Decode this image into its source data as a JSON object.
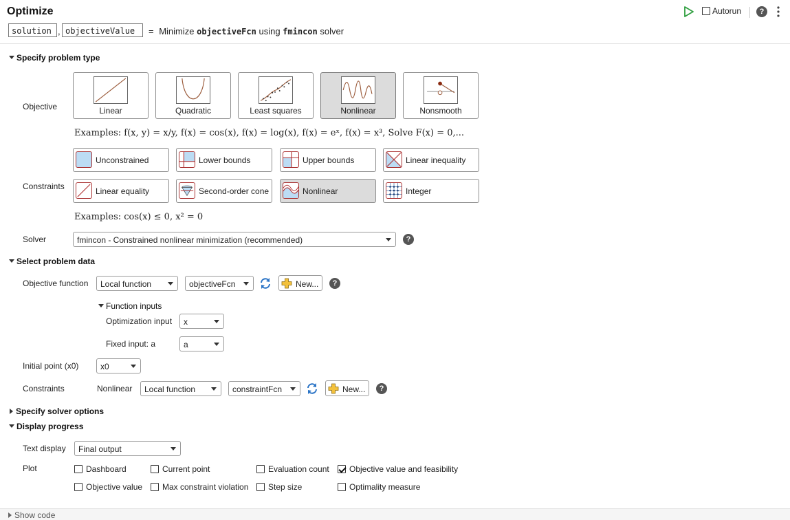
{
  "header": {
    "title": "Optimize",
    "outputs": [
      "solution",
      "objectiveValue"
    ],
    "comma": ",",
    "summary_eq": "=",
    "summary_minimize": "Minimize",
    "summary_fcn": "objectiveFcn",
    "summary_using": "using",
    "summary_solver": "fmincon",
    "summary_solver_word": "solver",
    "autorun_label": "Autorun",
    "autorun_checked": false
  },
  "problem_type": {
    "section_label": "Specify problem type",
    "objective_label": "Objective",
    "objectives": [
      {
        "label": "Linear",
        "icon": "linear-graph-icon",
        "selected": false
      },
      {
        "label": "Quadratic",
        "icon": "quadratic-graph-icon",
        "selected": false
      },
      {
        "label": "Least squares",
        "icon": "least-squares-graph-icon",
        "selected": false
      },
      {
        "label": "Nonlinear",
        "icon": "nonlinear-graph-icon",
        "selected": true
      },
      {
        "label": "Nonsmooth",
        "icon": "nonsmooth-graph-icon",
        "selected": false
      }
    ],
    "objective_examples": "Examples: f(x, y) = x/y, f(x) = cos(x), f(x) = log(x), f(x) = eˣ, f(x) = x³, Solve F(x) = 0,...",
    "constraints_label": "Constraints",
    "constraints": [
      {
        "label": "Unconstrained",
        "icon": "unconstrained-icon",
        "selected": false
      },
      {
        "label": "Lower bounds",
        "icon": "lower-bounds-icon",
        "selected": false
      },
      {
        "label": "Upper bounds",
        "icon": "upper-bounds-icon",
        "selected": false
      },
      {
        "label": "Linear inequality",
        "icon": "linear-inequality-icon",
        "selected": false
      },
      {
        "label": "Linear equality",
        "icon": "linear-equality-icon",
        "selected": false
      },
      {
        "label": "Second-order cone",
        "icon": "second-order-cone-icon",
        "selected": false
      },
      {
        "label": "Nonlinear",
        "icon": "nonlinear-constraint-icon",
        "selected": true
      },
      {
        "label": "Integer",
        "icon": "integer-icon",
        "selected": false
      }
    ],
    "constraint_examples": "Examples: cos(x) ≤ 0, x² = 0",
    "solver_label": "Solver",
    "solver_value": "fmincon - Constrained nonlinear minimization (recommended)"
  },
  "problem_data": {
    "section_label": "Select problem data",
    "objective_function_label": "Objective function",
    "objective_source": "Local function",
    "objective_fcn": "objectiveFcn",
    "new_label": "New...",
    "function_inputs_label": "Function inputs",
    "optimization_input_label": "Optimization input",
    "optimization_input_value": "x",
    "fixed_input_label": "Fixed input: a",
    "fixed_input_value": "a",
    "initial_point_label": "Initial point (x0)",
    "initial_point_value": "x0",
    "constraints_label": "Constraints",
    "nonlinear_label": "Nonlinear",
    "constraint_source": "Local function",
    "constraint_fcn": "constraintFcn"
  },
  "solver_options": {
    "section_label": "Specify solver options"
  },
  "display_progress": {
    "section_label": "Display progress",
    "text_display_label": "Text display",
    "text_display_value": "Final output",
    "plot_label": "Plot",
    "plots": [
      {
        "label": "Dashboard",
        "checked": false
      },
      {
        "label": "Current point",
        "checked": false
      },
      {
        "label": "Evaluation count",
        "checked": false
      },
      {
        "label": "Objective value and feasibility",
        "checked": true
      },
      {
        "label": "Objective value",
        "checked": false
      },
      {
        "label": "Max constraint violation",
        "checked": false
      },
      {
        "label": "Step size",
        "checked": false
      },
      {
        "label": "Optimality measure",
        "checked": false
      }
    ]
  },
  "footer": {
    "show_code_label": "Show code"
  },
  "colors": {
    "run_green": "#2e9e3e",
    "curve_brown": "#9a5a3a",
    "constraint_red": "#b03030",
    "feasible_blue": "#bcdcf4",
    "refresh_blue": "#2b74c6",
    "plus_yellow": "#f3c13c"
  }
}
